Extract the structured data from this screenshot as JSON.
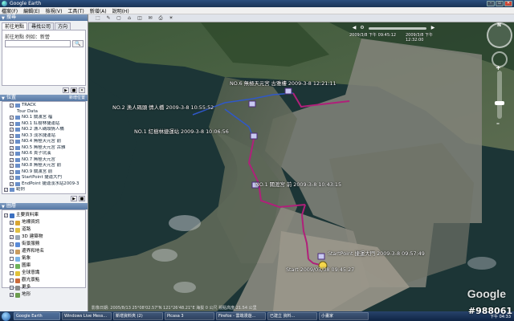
{
  "window": {
    "title": "Google Earth"
  },
  "menu": [
    "檔案(F)",
    "編輯(E)",
    "檢視(V)",
    "工具(T)",
    "新增(A)",
    "說明(H)"
  ],
  "search": {
    "header": "搜尋",
    "tabs": [
      "前往地點",
      "尋找公司",
      "方向"
    ],
    "label": "前往地點 例如：新營",
    "placeholder": "",
    "button": "搜尋"
  },
  "places": {
    "header": "位置",
    "header_right": "新增位置",
    "items": [
      {
        "label": "TRACK",
        "indent": 1,
        "sub": false
      },
      {
        "label": "Tour Data",
        "indent": 2,
        "sub": true
      },
      {
        "label": "NO.1 關渡宮 福",
        "indent": 1,
        "sub": false
      },
      {
        "label": "NO.1 紅樹林捷運站",
        "indent": 1,
        "sub": false
      },
      {
        "label": "NO.2 漁人碼頭情人橋",
        "indent": 1,
        "sub": false
      },
      {
        "label": "NO.3 淡水捷運站",
        "indent": 1,
        "sub": false
      },
      {
        "label": "NO.4 無極天元宮 前",
        "indent": 1,
        "sub": false
      },
      {
        "label": "NO.5 無極天元宮 古雅",
        "indent": 1,
        "sub": false
      },
      {
        "label": "NO.6 貴子坑溪",
        "indent": 1,
        "sub": false
      },
      {
        "label": "NO.7 無極天元宮",
        "indent": 1,
        "sub": false
      },
      {
        "label": "NO.8 無極天元宮 前",
        "indent": 1,
        "sub": false
      },
      {
        "label": "NO.9 關渡宮 前",
        "indent": 1,
        "sub": false
      },
      {
        "label": "StartPoint 捷運大門",
        "indent": 1,
        "sub": false
      },
      {
        "label": "EndPoint 捷運淡水站2009-3",
        "indent": 1,
        "sub": false
      },
      {
        "label": "範例",
        "indent": 0,
        "sub": false
      },
      {
        "label": "暫存位置",
        "indent": 0,
        "sub": false
      },
      {
        "label": "2009/03/08 07:55",
        "indent": 1,
        "sub": false
      }
    ]
  },
  "layers": {
    "header": "圖層",
    "items": [
      {
        "label": "主要資料庫",
        "color": "#3b6fc0",
        "checked": true
      },
      {
        "label": "地標資訊",
        "color": "#d9a531",
        "checked": true
      },
      {
        "label": "道路",
        "color": "#e0c044",
        "checked": true
      },
      {
        "label": "3D 建築物",
        "color": "#9aa7b6",
        "checked": true
      },
      {
        "label": "街景服務",
        "color": "#5a8bd8",
        "checked": true
      },
      {
        "label": "邊界和地名",
        "color": "#c99c5f",
        "checked": true
      },
      {
        "label": "氣象",
        "color": "#7ab3e6",
        "checked": false
      },
      {
        "label": "圖庫",
        "color": "#6fb35a",
        "checked": false
      },
      {
        "label": "全球意識",
        "color": "#e1c23a",
        "checked": false
      },
      {
        "label": "觀光景點",
        "color": "#cc6a3a",
        "checked": false
      },
      {
        "label": "更多",
        "color": "#8a8a8a",
        "checked": false
      },
      {
        "label": "地形",
        "color": "#6b9c4d",
        "checked": true
      }
    ]
  },
  "toolbar": [
    "⬚",
    "✎",
    "▢",
    "⌂",
    "◫",
    "✉",
    "⎙",
    "☀"
  ],
  "route_labels": [
    "NO.6 無極天元宮 古雅樓 2009-3-8 12:21:11",
    "NO.2 漁人碼頭 情人橋 2009-3-8 10:55:52",
    "NO.1 紅樹林捷運站 2009-3-8 10:06:56",
    "NO.1 關渡宮 前 2009-3-8 10:43:15",
    "StartPoint 捷運大門 2009-3-8 09:57:49",
    "Start 2009/03/08 09:45:27"
  ],
  "timeslider": {
    "start": "2009/3/8 下午 09:45:12",
    "end": "2009/3/8 下午 12:32:00"
  },
  "nav": {
    "north": "N"
  },
  "status": {
    "text": "影像日期: 2005/8/13  25°08'02.57\"N 121°26'48.21\"E 海拔 0 公尺     視點高度 21.54 公里"
  },
  "taskbar": [
    "Google Earth",
    "Windows Live Mess...",
    "新增資料夾 (2)",
    "Picasa 3",
    "Firefox - 雲端漫遊...",
    "已建立 資料...",
    "小畫家"
  ],
  "tray": "下午 04:33",
  "watermark": "#988061",
  "brand": "Google"
}
